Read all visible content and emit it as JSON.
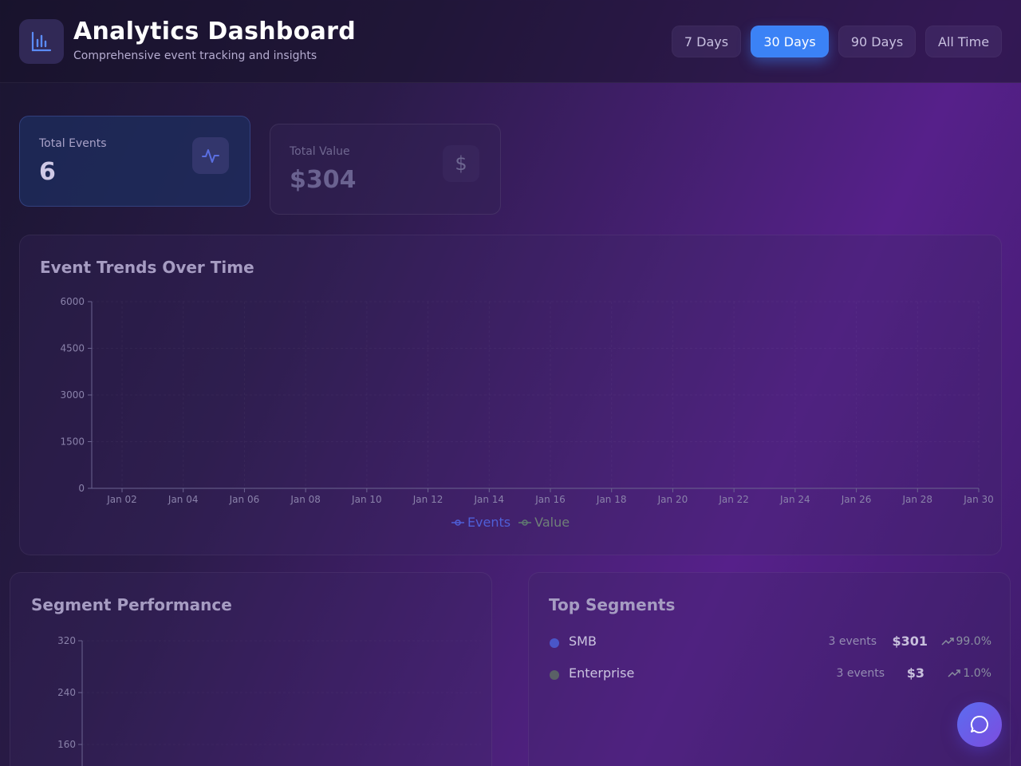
{
  "header": {
    "title": "Analytics Dashboard",
    "subtitle": "Comprehensive event tracking and insights",
    "ranges": [
      {
        "label": "7 Days",
        "active": false
      },
      {
        "label": "30 Days",
        "active": true
      },
      {
        "label": "90 Days",
        "active": false
      },
      {
        "label": "All Time",
        "active": false
      }
    ]
  },
  "stats": [
    {
      "label": "Total Events",
      "value": "6",
      "icon": "activity-icon"
    },
    {
      "label": "Total Value",
      "value": "$304",
      "icon": "dollar-icon",
      "icon_glyph": "$"
    }
  ],
  "trend_chart": {
    "title": "Event Trends Over Time",
    "chart_data": {
      "type": "line",
      "title": "Event Trends Over Time",
      "xlabel": "",
      "ylabel": "",
      "ylim": [
        0,
        6000
      ],
      "y_ticks": [
        "0",
        "1500",
        "3000",
        "4500",
        "6000"
      ],
      "x_ticks": [
        "Jan 02",
        "Jan 04",
        "Jan 06",
        "Jan 08",
        "Jan 10",
        "Jan 12",
        "Jan 14",
        "Jan 16",
        "Jan 18",
        "Jan 20",
        "Jan 22",
        "Jan 24",
        "Jan 26",
        "Jan 28",
        "Jan 30"
      ],
      "series": [
        {
          "name": "Events",
          "color": "#4f5fd8",
          "values": []
        },
        {
          "name": "Value",
          "color": "#5f7a70",
          "values": []
        }
      ],
      "grid": true,
      "legend": "bottom-center"
    }
  },
  "segment_chart": {
    "title": "Segment Performance",
    "chart_data": {
      "type": "bar",
      "ylim": [
        160,
        320
      ],
      "y_ticks": [
        "320",
        "240",
        "160"
      ],
      "categories": [],
      "values": []
    }
  },
  "top_segments": {
    "title": "Top Segments",
    "items": [
      {
        "name": "SMB",
        "events": "3 events",
        "value": "$301",
        "share": "99.0%",
        "color": "#4a56c8"
      },
      {
        "name": "Enterprise",
        "events": "3 events",
        "value": "$3",
        "share": "1.0%",
        "color": "#5a6066"
      }
    ]
  },
  "chat": {
    "icon": "chat-bubble-icon"
  }
}
